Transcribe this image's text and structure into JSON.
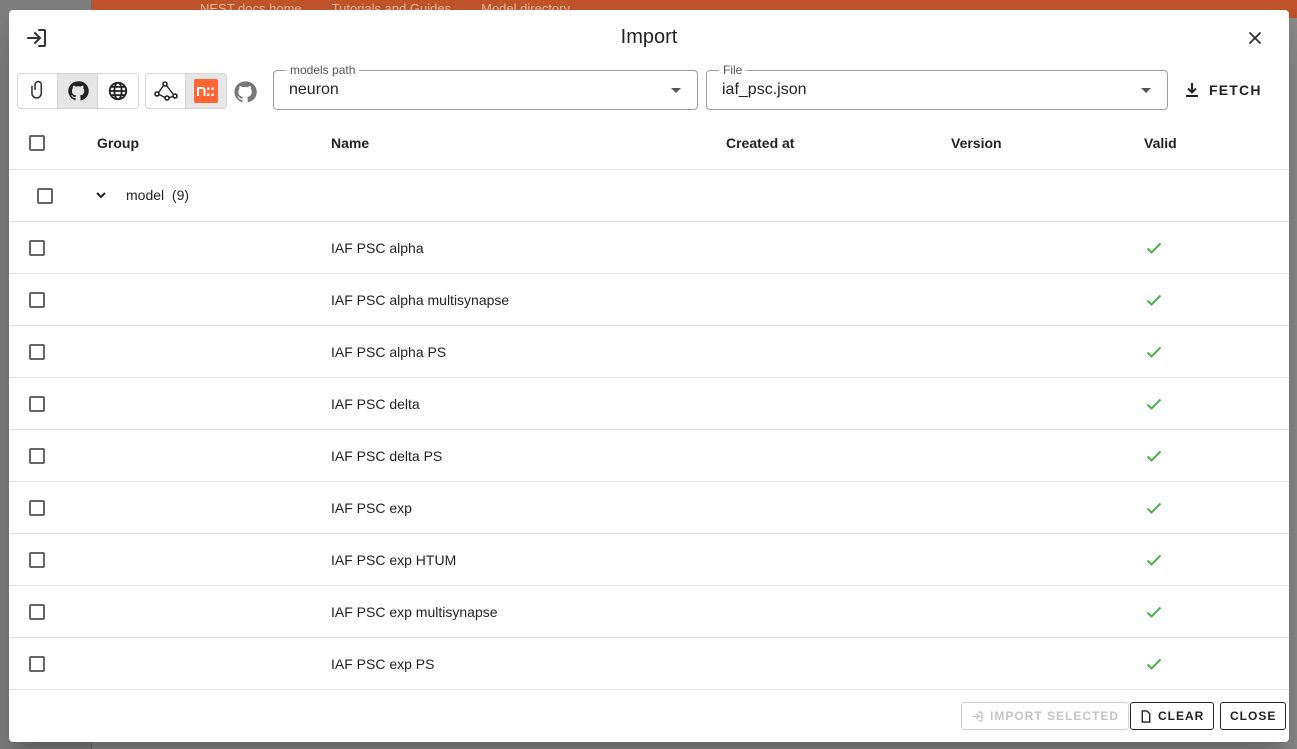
{
  "background": {
    "links": [
      "NEST docs home",
      "Tutorials and Guides",
      "Model directory"
    ]
  },
  "dialog": {
    "title": "Import",
    "title_icon": "import-icon",
    "close_icon": "close-icon"
  },
  "toolbar": {
    "source_buttons": [
      {
        "icon": "paperclip-icon",
        "active": false
      },
      {
        "icon": "github-icon",
        "active": true
      },
      {
        "icon": "globe-icon",
        "active": false
      }
    ],
    "format_buttons": [
      {
        "icon": "graph-icon",
        "active": false
      },
      {
        "icon": "nest-logo-icon",
        "active": true
      }
    ],
    "repo_icon": "github-icon",
    "models_path": {
      "label": "models path",
      "value": "neuron"
    },
    "file": {
      "label": "File",
      "value": "iaf_psc.json"
    },
    "fetch_label": "FETCH"
  },
  "table": {
    "headers": {
      "group": "Group",
      "name": "Name",
      "created_at": "Created at",
      "version": "Version",
      "valid": "Valid"
    },
    "group_label": "model",
    "group_count": "(9)",
    "rows": [
      {
        "name": "IAF PSC alpha",
        "valid": true
      },
      {
        "name": "IAF PSC alpha multisynapse",
        "valid": true
      },
      {
        "name": "IAF PSC alpha PS",
        "valid": true
      },
      {
        "name": "IAF PSC delta",
        "valid": true
      },
      {
        "name": "IAF PSC delta PS",
        "valid": true
      },
      {
        "name": "IAF PSC exp",
        "valid": true
      },
      {
        "name": "IAF PSC exp HTUM",
        "valid": true
      },
      {
        "name": "IAF PSC exp multisynapse",
        "valid": true
      },
      {
        "name": "IAF PSC exp PS",
        "valid": true
      }
    ]
  },
  "footer": {
    "import_selected": "IMPORT SELECTED",
    "clear": "CLEAR",
    "close": "CLOSE"
  },
  "colors": {
    "accent": "#ff6633",
    "valid": "#4caf50",
    "header_bar": "#c0532a"
  }
}
